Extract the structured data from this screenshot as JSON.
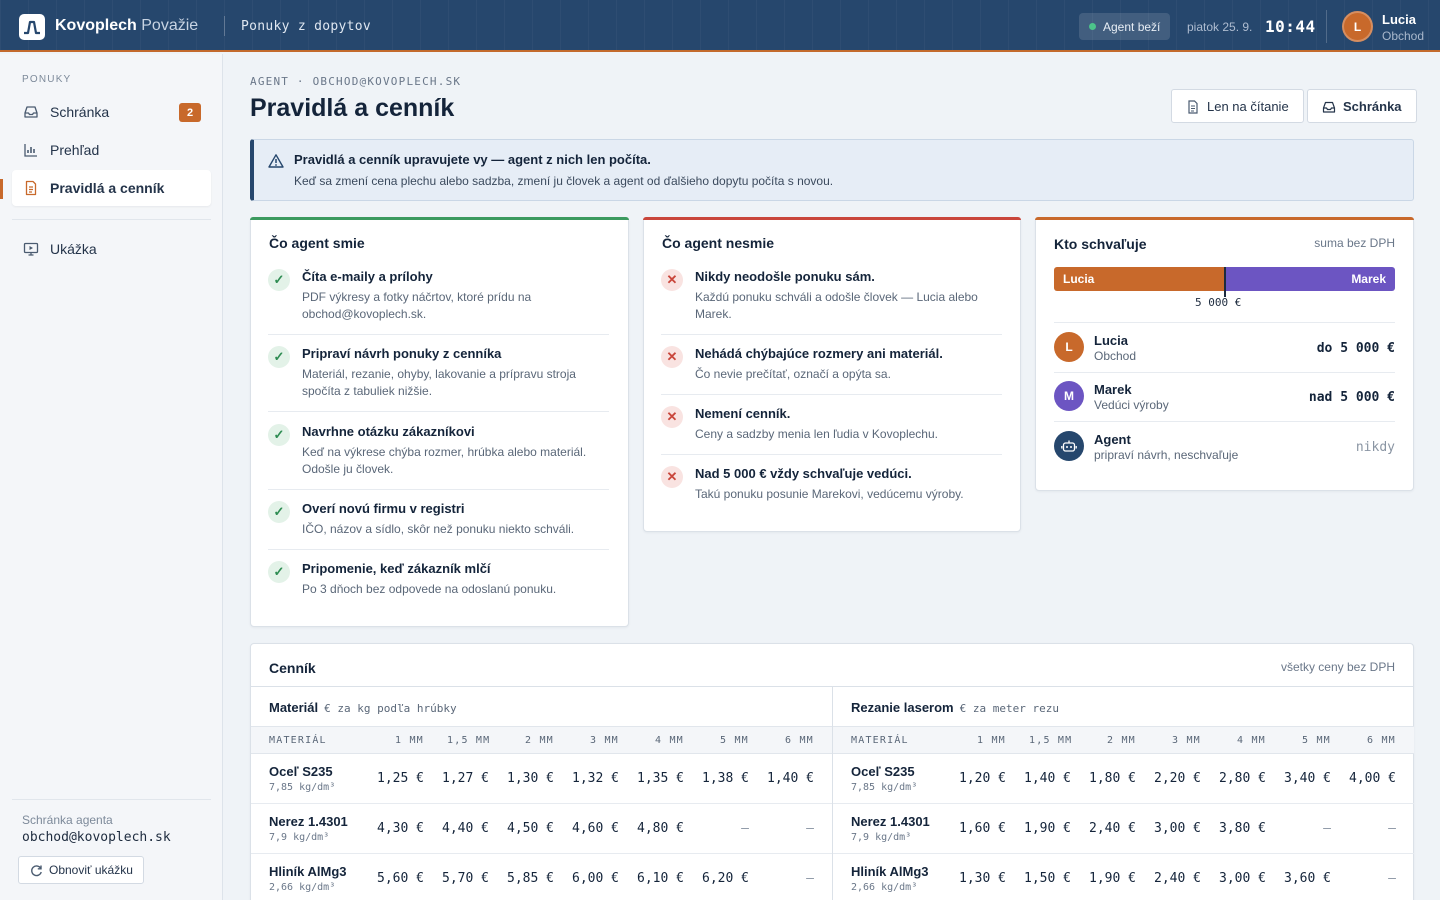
{
  "topbar": {
    "brand": "Kovoplech",
    "brand_suffix": "Považie",
    "title": "Ponuky z dopytov",
    "agent_status": "Agent beží",
    "date": "piatok 25. 9.",
    "time": "10:44",
    "user": {
      "initial": "L",
      "name": "Lucia",
      "role": "Obchod"
    }
  },
  "sidebar": {
    "section": "PONUKY",
    "items": [
      {
        "label": "Schránka",
        "icon": "inbox-icon",
        "count": "2"
      },
      {
        "label": "Prehľad",
        "icon": "chart-icon"
      },
      {
        "label": "Pravidlá a cenník",
        "icon": "document-icon",
        "active": true
      },
      {
        "label": "Ukážka",
        "icon": "monitor-icon"
      }
    ],
    "mailbox_label": "Schránka agenta",
    "mailbox": "obchod@kovoplech.sk",
    "reset_label": "Obnoviť ukážku"
  },
  "header": {
    "eyebrow": "AGENT · OBCHOD@KOVOPLECH.SK",
    "title": "Pravidlá a cenník",
    "readonly_label": "Len na čítanie",
    "inbox_label": "Schránka"
  },
  "notice": {
    "title": "Pravidlá a cenník upravujete vy — agent z nich len počíta.",
    "text": "Keď sa zmení cena plechu alebo sadzba, zmení ju človek a agent od ďalšieho dopytu počíta s novou."
  },
  "can": {
    "title": "Čo agent smie",
    "accent": "#3c9a5f",
    "items": [
      {
        "title": "Číta e-maily a prílohy",
        "desc": "PDF výkresy a fotky náčrtov, ktoré prídu na obchod@kovoplech.sk."
      },
      {
        "title": "Pripraví návrh ponuky z cenníka",
        "desc": "Materiál, rezanie, ohyby, lakovanie a prípravu stroja spočíta z tabuliek nižšie."
      },
      {
        "title": "Navrhne otázku zákazníkovi",
        "desc": "Keď na výkrese chýba rozmer, hrúbka alebo materiál. Odošle ju človek."
      },
      {
        "title": "Overí novú firmu v registri",
        "desc": "IČO, názov a sídlo, skôr než ponuku niekto schváli."
      },
      {
        "title": "Pripomenie, keď zákazník mlčí",
        "desc": "Po 3 dňoch bez odpovede na odoslanú ponuku."
      }
    ]
  },
  "cannot": {
    "title": "Čo agent nesmie",
    "accent": "#c9463b",
    "items": [
      {
        "title": "Nikdy neodošle ponuku sám.",
        "desc": "Každú ponuku schváli a odošle človek — Lucia alebo Marek."
      },
      {
        "title": "Nehádá chýbajúce rozmery ani materiál.",
        "desc": "Čo nevie prečítať, označí a opýta sa."
      },
      {
        "title": "Nemení cenník.",
        "desc": "Ceny a sadzby menia len ľudia v Kovoplechu."
      },
      {
        "title": "Nad 5 000 € vždy schvaľuje vedúci.",
        "desc": "Takú ponuku posunie Marekovi, vedúcemu výroby."
      }
    ]
  },
  "approvals": {
    "title": "Kto schvaľuje",
    "note": "suma bez DPH",
    "accent": "#c8692b",
    "bar_left": "Lucia",
    "bar_right": "Marek",
    "threshold": "5 000 €",
    "rows": [
      {
        "initial": "L",
        "name": "Lucia",
        "role": "Obchod",
        "limit": "do 5 000 €",
        "color": "#c8692b"
      },
      {
        "initial": "M",
        "name": "Marek",
        "role": "Vedúci výroby",
        "limit": "nad 5 000 €",
        "color": "#6c55c2"
      },
      {
        "icon": "robot-icon",
        "name": "Agent",
        "role": "pripraví návrh, neschvaľuje",
        "limit": "nikdy",
        "color": "#26476d"
      }
    ]
  },
  "pricelist": {
    "title": "Cenník",
    "note": "všetky ceny bez DPH",
    "columns": [
      "MATERIÁL",
      "1 MM",
      "1,5 MM",
      "2 MM",
      "3 MM",
      "4 MM",
      "5 MM",
      "6 MM"
    ],
    "material": {
      "title": "Materiál",
      "unit": "€ za kg podľa hrúbky",
      "rows": [
        {
          "name": "Oceľ S235",
          "density": "7,85 kg/dm³",
          "values": [
            "1,25 €",
            "1,27 €",
            "1,30 €",
            "1,32 €",
            "1,35 €",
            "1,38 €",
            "1,40 €"
          ]
        },
        {
          "name": "Nerez 1.4301",
          "density": "7,9 kg/dm³",
          "values": [
            "4,30 €",
            "4,40 €",
            "4,50 €",
            "4,60 €",
            "4,80 €",
            "—",
            "—"
          ]
        },
        {
          "name": "Hliník AlMg3",
          "density": "2,66 kg/dm³",
          "values": [
            "5,60 €",
            "5,70 €",
            "5,85 €",
            "6,00 €",
            "6,10 €",
            "6,20 €",
            "—"
          ]
        }
      ]
    },
    "laser": {
      "title": "Rezanie laserom",
      "unit": "€ za meter rezu",
      "rows": [
        {
          "name": "Oceľ S235",
          "density": "7,85 kg/dm³",
          "values": [
            "1,20 €",
            "1,40 €",
            "1,80 €",
            "2,20 €",
            "2,80 €",
            "3,40 €",
            "4,00 €"
          ]
        },
        {
          "name": "Nerez 1.4301",
          "density": "7,9 kg/dm³",
          "values": [
            "1,60 €",
            "1,90 €",
            "2,40 €",
            "3,00 €",
            "3,80 €",
            "—",
            "—"
          ]
        },
        {
          "name": "Hliník AlMg3",
          "density": "2,66 kg/dm³",
          "values": [
            "1,30 €",
            "1,50 €",
            "1,90 €",
            "2,40 €",
            "3,00 €",
            "3,60 €",
            "—"
          ]
        }
      ]
    }
  }
}
